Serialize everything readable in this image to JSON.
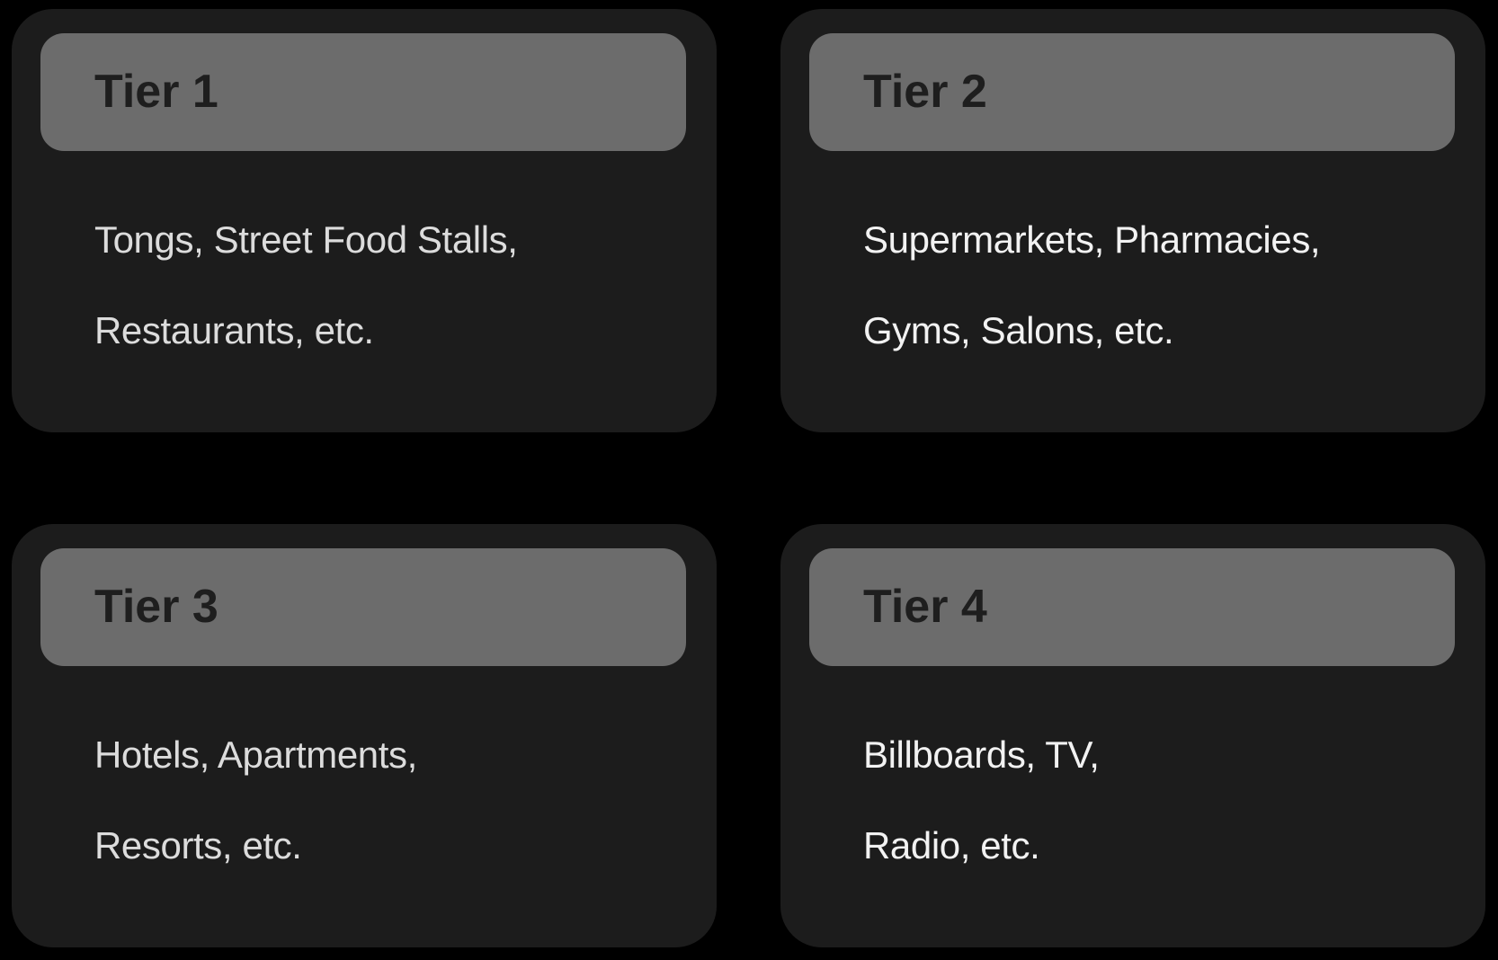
{
  "tiers": [
    {
      "title": "Tier 1",
      "lines": [
        "Tongs, Street Food Stalls,",
        "Restaurants, etc."
      ]
    },
    {
      "title": "Tier 2",
      "lines": [
        "Supermarkets, Pharmacies,",
        "Gyms, Salons, etc."
      ]
    },
    {
      "title": "Tier 3",
      "lines": [
        "Hotels, Apartments,",
        "Resorts, etc."
      ]
    },
    {
      "title": "Tier 4",
      "lines": [
        "Billboards, TV,",
        "Radio, etc."
      ]
    }
  ]
}
